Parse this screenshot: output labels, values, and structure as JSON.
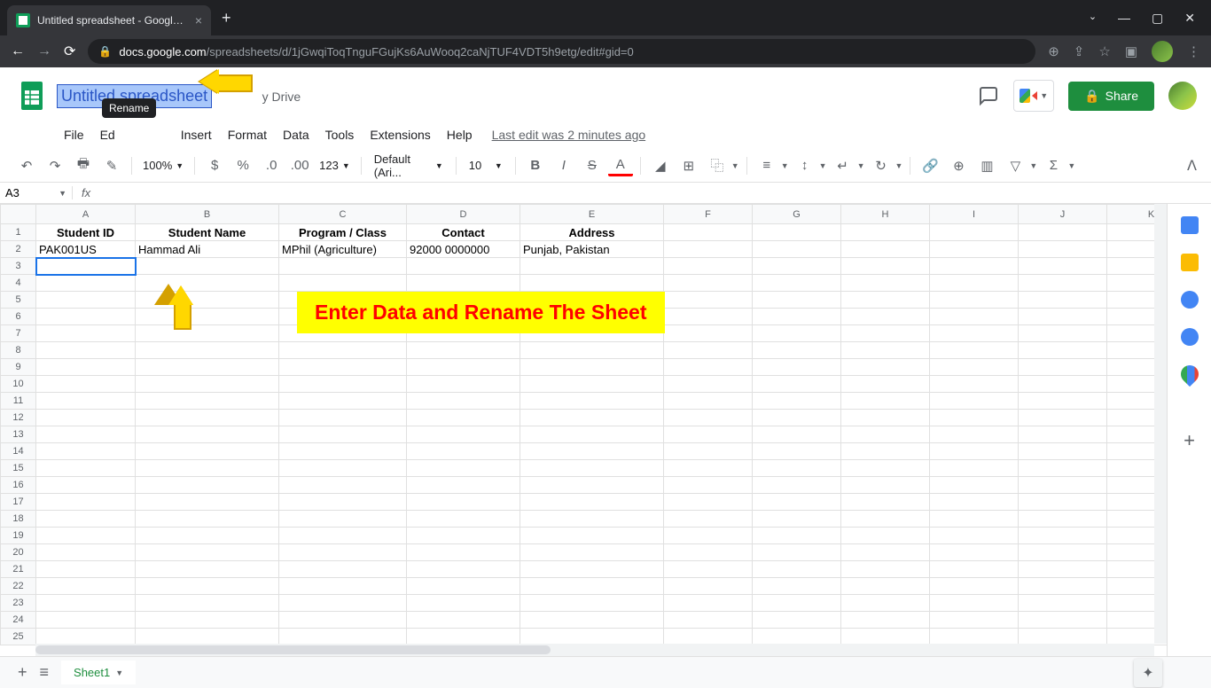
{
  "browser": {
    "tab_title": "Untitled spreadsheet - Google Sheets",
    "url_host": "docs.google.com",
    "url_path": "/spreadsheets/d/1jGwqiToqTnguFGujKs6AuWooq2caNjTUF4VDT5h9etg/edit#gid=0"
  },
  "doc": {
    "title": "Untitled spreadsheet",
    "title_suffix": "y Drive",
    "last_edit": "Last edit was 2 minutes ago",
    "share": "Share"
  },
  "tooltip": "Rename",
  "menus": [
    "File",
    "Ed",
    "Insert",
    "Format",
    "Data",
    "Tools",
    "Extensions",
    "Help"
  ],
  "toolbar": {
    "zoom": "100%",
    "font": "Default (Ari...",
    "size": "10",
    "number_format": "123"
  },
  "namebox": "A3",
  "columns": [
    "A",
    "B",
    "C",
    "D",
    "E",
    "F",
    "G",
    "H",
    "I",
    "J",
    "K"
  ],
  "headers": [
    "Student ID",
    "Student Name",
    "Program / Class",
    "Contact",
    "Address"
  ],
  "row2": [
    "PAK001US",
    "Hammad Ali",
    "MPhil (Agriculture)",
    "92000 0000000",
    "Punjab, Pakistan"
  ],
  "annotation": "Enter Data and Rename The Sheet",
  "sheet_tab": "Sheet1"
}
